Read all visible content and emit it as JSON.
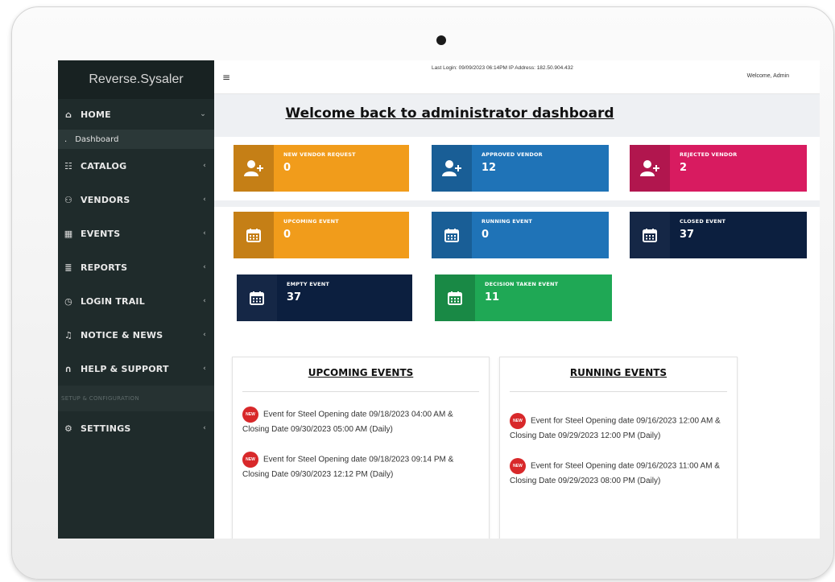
{
  "sidebar": {
    "brand": "Reverse.Sysaler",
    "home": {
      "label": "HOME",
      "icon": "home-icon"
    },
    "home_sub": {
      "label": "Dashboard",
      "bullet": "."
    },
    "items": [
      {
        "label": "CATALOG",
        "icon": "sitemap-icon"
      },
      {
        "label": "VENDORS",
        "icon": "user-plus-icon"
      },
      {
        "label": "EVENTS",
        "icon": "calendar-icon"
      },
      {
        "label": "REPORTS",
        "icon": "chart-icon"
      },
      {
        "label": "LOGIN TRAIL",
        "icon": "clock-icon"
      },
      {
        "label": "NOTICE & NEWS",
        "icon": "bell-icon"
      },
      {
        "label": "HELP & SUPPORT",
        "icon": "headset-icon"
      }
    ],
    "section_label": "SETUP & CONFIGURATION",
    "settings": {
      "label": "SETTINGS",
      "icon": "gear-icon"
    }
  },
  "topbar": {
    "menu_glyph": "≡",
    "last_login": "Last Login: 09/09/2023 06:14PM IP Address: 182.50.904.432",
    "welcome_user": "Welcome, Admin"
  },
  "page_title": "Welcome back to administrator dashboard",
  "cards": [
    {
      "title": "NEW VENDOR REQUEST",
      "value": "0",
      "color": "#f19c1b",
      "icon": "user-plus-icon"
    },
    {
      "title": "APPROVED VENDOR",
      "value": "12",
      "color": "#1f73b7",
      "icon": "user-plus-icon"
    },
    {
      "title": "REJECTED VENDOR",
      "value": "2",
      "color": "#d81b60",
      "icon": "user-plus-icon"
    },
    {
      "title": "UPCOMING EVENT",
      "value": "0",
      "color": "#f19c1b",
      "icon": "calendar-icon"
    },
    {
      "title": "RUNNING EVENT",
      "value": "0",
      "color": "#1f73b7",
      "icon": "calendar-icon"
    },
    {
      "title": "CLOSED EVENT",
      "value": "37",
      "color": "#0c1f3f",
      "icon": "calendar-icon"
    },
    {
      "title": "EMPTY EVENT",
      "value": "37",
      "color": "#0c1f3f",
      "icon": "calendar-icon"
    },
    {
      "title": "DECISION TAKEN EVENT",
      "value": "11",
      "color": "#1fa855",
      "icon": "calendar-icon"
    }
  ],
  "upcoming": {
    "title": "UPCOMING EVENTS",
    "events": [
      "Event for Steel Opening date 09/18/2023 04:00 AM & Closing Date 09/30/2023 05:00 AM (Daily)",
      "Event for Steel Opening date 09/18/2023 09:14 PM & Closing Date 09/30/2023 12:12 PM (Daily)"
    ]
  },
  "running": {
    "title": "RUNNING EVENTS",
    "events": [
      "Event for Steel Opening date 09/16/2023 12:00 AM & Closing Date 09/29/2023 12:00 PM (Daily)",
      "Event for Steel Opening date 09/16/2023 11:00 AM & Closing Date 09/29/2023 08:00 PM (Daily)"
    ]
  }
}
